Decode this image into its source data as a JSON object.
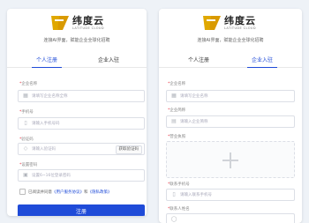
{
  "brand": {
    "name_cn": "纬度云",
    "name_en": "LATITUDE CLOUD",
    "accent": "#1f4bd8",
    "logo_gold": "#e0a800"
  },
  "left_card": {
    "subtitle": "连接AI界面，赋能企业全球化招聘",
    "tabs": [
      "个人注册",
      "企业入驻"
    ],
    "active_tab": 0,
    "fields": [
      {
        "label": "企业名称",
        "placeholder": "请填写企业名称全称",
        "icon": "building-icon"
      },
      {
        "label": "手机号",
        "placeholder": "请输入手机号码",
        "icon": "phone-icon"
      },
      {
        "label": "验证码",
        "placeholder": "请输入验证码",
        "icon": "shield-icon",
        "button": "获取验证码"
      },
      {
        "label": "设置密码",
        "placeholder": "设置6~16位登录密码",
        "icon": "lock-icon"
      }
    ],
    "agree_prefix": "已阅读并同意",
    "agree_link1": "《用户服务协议》",
    "agree_and": "和",
    "agree_link2": "《隐私政策》",
    "submit": "注册"
  },
  "right_card": {
    "subtitle": "连接AI界面，赋能企业全球化招聘",
    "tabs": [
      "个人注册",
      "企业入驻"
    ],
    "active_tab": 1,
    "fields_top": [
      {
        "label": "企业名称",
        "placeholder": "请填写企业名称"
      },
      {
        "label": "企业简称",
        "placeholder": "请输入企业简称"
      }
    ],
    "upload_label": "营业执照",
    "fields_bottom": [
      {
        "label": "联系手机号",
        "placeholder": "请输入联系手机号",
        "icon": "phone-icon"
      },
      {
        "label": "联系人姓名",
        "placeholder": ""
      }
    ]
  }
}
